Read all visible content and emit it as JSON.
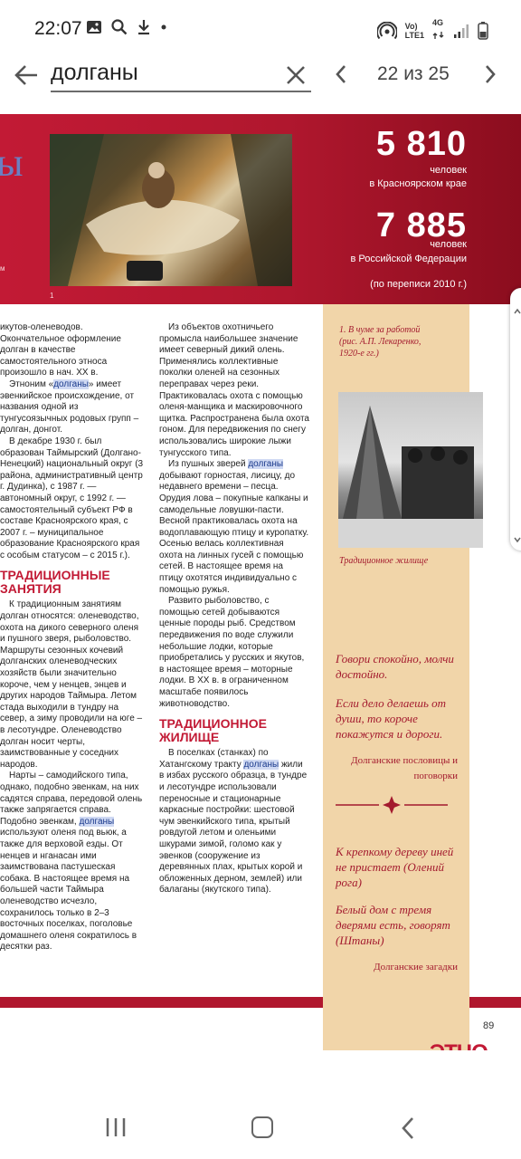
{
  "status_bar": {
    "time": "22:07",
    "network_line1": "Vo)",
    "network_line2": "LTE1",
    "network_type": "4G",
    "icons": [
      "image-icon",
      "search-icon",
      "download-icon",
      "dot-icon",
      "hotspot-icon",
      "signal-icon",
      "battery-icon"
    ]
  },
  "search": {
    "query": "долганы",
    "match_counter": "22 из 25"
  },
  "banner": {
    "letter": "ы",
    "photo_number": "1",
    "stat1_number": "5 810",
    "stat1_label1": "человек",
    "stat1_label2": "в  Красноярском крае",
    "stat2_number": "7 885",
    "stat2_label1": "человек",
    "stat2_label2": "в  Российской Федерации",
    "census_note": "(по переписи 2010 г.)"
  },
  "sidebar": {
    "painting_caption": "1. В чуме за работой (рис. А.П. Лекаренко, 1920-е гг.)",
    "photo_caption": "Традиционное жилище",
    "proverb1": "Говори спокойно, молчи достойно.",
    "proverb2": "Если дело делаешь от души, то короче покажутся и дороги.",
    "proverb_source": "Долганские пословицы и поговорки",
    "riddle1": "К крепкому дереву иней не пристает (Олений рога)",
    "riddle2": "Белый дом с тремя дверями есть, говорят (Штаны)",
    "riddle_source": "Долганские загадки"
  },
  "left_column": {
    "p1": "икутов-оленеводов. Окончательное оформление долган в качестве самостоятельного этноса произошло в нач. XX в.",
    "p2_before": "Этноним «",
    "p2_hl": "долганы",
    "p2_after": "» имеет эвенкийское происхождение, от названия одной из тунгусоязычных родовых групп – долган, донгот.",
    "p3": "В декабре 1930 г. был образован Таймырский (Долгано-Ненецкий) национальный округ (3 района, административный центр г. Дудинка), с 1987 г. — автономный округ, с 1992 г. — самостоятельный субъект РФ в составе Красноярского края, с 2007 г. – муниципальное образование Красноярского края с особым статусом – с 2015 г.).",
    "heading": "Традиционные занятия",
    "p4": "К традиционным занятиям долган относятся: оленеводство, охота на дикого северного оленя и пушного зверя, рыболовство. Маршруты сезонных кочевий долганских оленеводческих хозяйств были значительно короче, чем у ненцев, энцев и других народов Таймыра. Летом стада выходили в тундру на север, а зиму проводили на юге – в лесотундре. Оленеводство долган носит черты, заимствованные у соседних народов.",
    "p5_before": "Нарты – самодийского типа, однако, подобно эвенкам, на них садятся справа, передовой олень также запрягается справа. Подобно эвенкам, ",
    "p5_hl": "долганы",
    "p5_after": " используют оленя под вьюк, а также для верховой езды. От ненцев и нганасан ими заимствована пастушеская собака. В настоящее время на большей части Таймыра оленеводство исчезло, сохранилось только в 2–3 восточных поселках, поголовье домашнего оленя сократилось в десятки раз."
  },
  "mid_column": {
    "p1": "Из объектов охотничьего промысла наибольшее значение имеет северный дикий олень. Применялись коллективные поколки оленей на сезонных переправах через реки. Практиковалась охота с помощью оленя-манщика и маскировочного щитка. Распространена была охота гоном. Для передвижения по снегу использовались широкие лыжи тунгусского типа.",
    "p2_before": "Из пушных зверей ",
    "p2_hl": "долганы",
    "p2_after": " добывают горностая, лисицу, до недавнего времени – песца. Орудия лова – покупные капканы и самодельные ловушки-пасти. Весной практиковалась охота на водоплавающую птицу и куропатку. Осенью велась коллективная охота на линных гусей с помощью сетей. В настоящее время на птицу охотятся индивидуально с помощью ружья.",
    "p3": "Развито рыболовство, с помощью сетей добываются ценные породы рыб. Средством передвижения по воде служили небольшие лодки, которые приобретались у русских и якутов, в настоящее время – моторные лодки. В XX в. в ограниченном масштабе появилось животноводство.",
    "heading": "Традиционное жилище",
    "p4_before": "В поселках (станках) по Хатангскому тракту ",
    "p4_hl": "долганы",
    "p4_after": " жили в избах русского образца, в тундре и лесотундре использовали переносные и стационарные каркасные постройки: шестовой чум эвенкийского типа, крытый ровдугой летом и оленьими шкурами зимой, голомо как у эвенков (сооружение из деревянных плах, крытых корой и обложенных дерном, землей) или балаганы (якутского типа)."
  },
  "footer": {
    "page_number": "89",
    "logo": "ЭТНО"
  },
  "colors": {
    "brand_red": "#c21a35",
    "sidebar_beige": "#f1d5a9",
    "highlight": "#cfd9f3"
  }
}
